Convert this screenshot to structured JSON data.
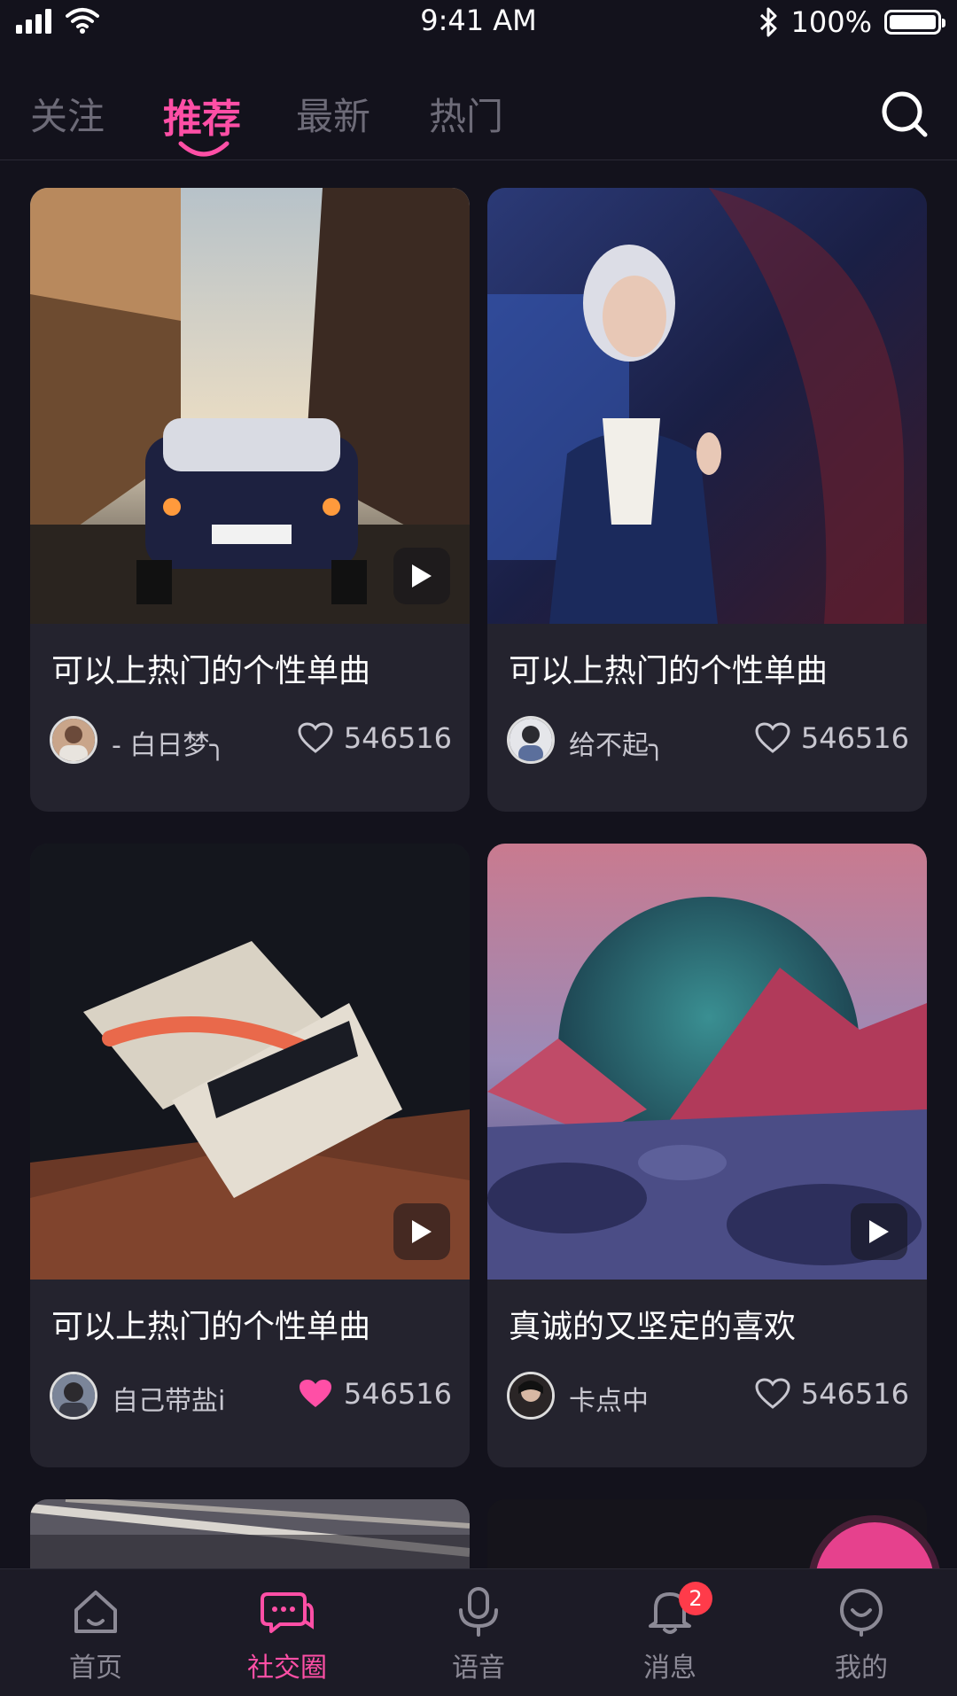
{
  "status_bar": {
    "time": "9:41 AM",
    "battery": "100%"
  },
  "tabs": [
    {
      "label": "关注"
    },
    {
      "label": "推荐"
    },
    {
      "label": "最新"
    },
    {
      "label": "热门"
    }
  ],
  "feed": [
    {
      "title": "可以上热门的个性单曲",
      "author": "- 白日梦╮",
      "likes": "546516",
      "liked": false,
      "media": "rally-car-photo",
      "is_video": true
    },
    {
      "title": "可以上热门的个性单曲",
      "author": "给不起╮",
      "likes": "546516",
      "liked": false,
      "media": "woman-portrait-photo",
      "is_video": false
    },
    {
      "title": "可以上热门的个性单曲",
      "author": "自己带盐i",
      "likes": "546516",
      "liked": true,
      "media": "typography-art-photo",
      "is_video": true
    },
    {
      "title": "真诚的又坚定的喜欢",
      "author": "卡点中",
      "likes": "546516",
      "liked": false,
      "media": "planet-landscape-art",
      "is_video": true
    }
  ],
  "bottom_nav": [
    {
      "label": "首页",
      "icon": "home-icon"
    },
    {
      "label": "社交圈",
      "icon": "chat-icon"
    },
    {
      "label": "语音",
      "icon": "mic-icon"
    },
    {
      "label": "消息",
      "icon": "bell-icon",
      "badge": "2"
    },
    {
      "label": "我的",
      "icon": "profile-icon"
    }
  ],
  "colors": {
    "accent": "#ff4fa6",
    "background": "#13121c",
    "card": "#24232e"
  }
}
